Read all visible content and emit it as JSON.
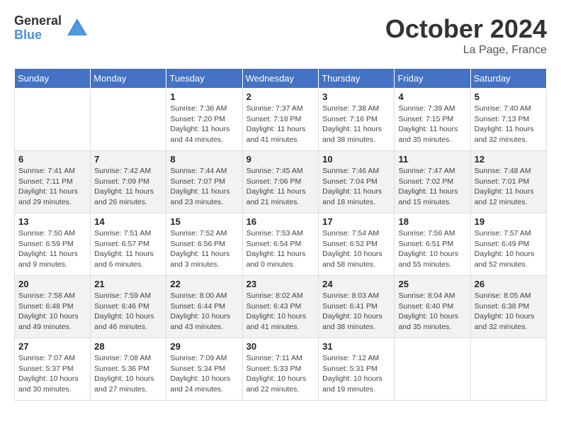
{
  "logo": {
    "general": "General",
    "blue": "Blue"
  },
  "title": "October 2024",
  "location": "La Page, France",
  "days_header": [
    "Sunday",
    "Monday",
    "Tuesday",
    "Wednesday",
    "Thursday",
    "Friday",
    "Saturday"
  ],
  "weeks": [
    [
      {
        "day": "",
        "info": ""
      },
      {
        "day": "",
        "info": ""
      },
      {
        "day": "1",
        "info": "Sunrise: 7:36 AM\nSunset: 7:20 PM\nDaylight: 11 hours and 44 minutes."
      },
      {
        "day": "2",
        "info": "Sunrise: 7:37 AM\nSunset: 7:18 PM\nDaylight: 11 hours and 41 minutes."
      },
      {
        "day": "3",
        "info": "Sunrise: 7:38 AM\nSunset: 7:16 PM\nDaylight: 11 hours and 38 minutes."
      },
      {
        "day": "4",
        "info": "Sunrise: 7:39 AM\nSunset: 7:15 PM\nDaylight: 11 hours and 35 minutes."
      },
      {
        "day": "5",
        "info": "Sunrise: 7:40 AM\nSunset: 7:13 PM\nDaylight: 11 hours and 32 minutes."
      }
    ],
    [
      {
        "day": "6",
        "info": "Sunrise: 7:41 AM\nSunset: 7:11 PM\nDaylight: 11 hours and 29 minutes."
      },
      {
        "day": "7",
        "info": "Sunrise: 7:42 AM\nSunset: 7:09 PM\nDaylight: 11 hours and 26 minutes."
      },
      {
        "day": "8",
        "info": "Sunrise: 7:44 AM\nSunset: 7:07 PM\nDaylight: 11 hours and 23 minutes."
      },
      {
        "day": "9",
        "info": "Sunrise: 7:45 AM\nSunset: 7:06 PM\nDaylight: 11 hours and 21 minutes."
      },
      {
        "day": "10",
        "info": "Sunrise: 7:46 AM\nSunset: 7:04 PM\nDaylight: 11 hours and 18 minutes."
      },
      {
        "day": "11",
        "info": "Sunrise: 7:47 AM\nSunset: 7:02 PM\nDaylight: 11 hours and 15 minutes."
      },
      {
        "day": "12",
        "info": "Sunrise: 7:48 AM\nSunset: 7:01 PM\nDaylight: 11 hours and 12 minutes."
      }
    ],
    [
      {
        "day": "13",
        "info": "Sunrise: 7:50 AM\nSunset: 6:59 PM\nDaylight: 11 hours and 9 minutes."
      },
      {
        "day": "14",
        "info": "Sunrise: 7:51 AM\nSunset: 6:57 PM\nDaylight: 11 hours and 6 minutes."
      },
      {
        "day": "15",
        "info": "Sunrise: 7:52 AM\nSunset: 6:56 PM\nDaylight: 11 hours and 3 minutes."
      },
      {
        "day": "16",
        "info": "Sunrise: 7:53 AM\nSunset: 6:54 PM\nDaylight: 11 hours and 0 minutes."
      },
      {
        "day": "17",
        "info": "Sunrise: 7:54 AM\nSunset: 6:52 PM\nDaylight: 10 hours and 58 minutes."
      },
      {
        "day": "18",
        "info": "Sunrise: 7:56 AM\nSunset: 6:51 PM\nDaylight: 10 hours and 55 minutes."
      },
      {
        "day": "19",
        "info": "Sunrise: 7:57 AM\nSunset: 6:49 PM\nDaylight: 10 hours and 52 minutes."
      }
    ],
    [
      {
        "day": "20",
        "info": "Sunrise: 7:58 AM\nSunset: 6:48 PM\nDaylight: 10 hours and 49 minutes."
      },
      {
        "day": "21",
        "info": "Sunrise: 7:59 AM\nSunset: 6:46 PM\nDaylight: 10 hours and 46 minutes."
      },
      {
        "day": "22",
        "info": "Sunrise: 8:00 AM\nSunset: 6:44 PM\nDaylight: 10 hours and 43 minutes."
      },
      {
        "day": "23",
        "info": "Sunrise: 8:02 AM\nSunset: 6:43 PM\nDaylight: 10 hours and 41 minutes."
      },
      {
        "day": "24",
        "info": "Sunrise: 8:03 AM\nSunset: 6:41 PM\nDaylight: 10 hours and 38 minutes."
      },
      {
        "day": "25",
        "info": "Sunrise: 8:04 AM\nSunset: 6:40 PM\nDaylight: 10 hours and 35 minutes."
      },
      {
        "day": "26",
        "info": "Sunrise: 8:05 AM\nSunset: 6:38 PM\nDaylight: 10 hours and 32 minutes."
      }
    ],
    [
      {
        "day": "27",
        "info": "Sunrise: 7:07 AM\nSunset: 5:37 PM\nDaylight: 10 hours and 30 minutes."
      },
      {
        "day": "28",
        "info": "Sunrise: 7:08 AM\nSunset: 5:36 PM\nDaylight: 10 hours and 27 minutes."
      },
      {
        "day": "29",
        "info": "Sunrise: 7:09 AM\nSunset: 5:34 PM\nDaylight: 10 hours and 24 minutes."
      },
      {
        "day": "30",
        "info": "Sunrise: 7:11 AM\nSunset: 5:33 PM\nDaylight: 10 hours and 22 minutes."
      },
      {
        "day": "31",
        "info": "Sunrise: 7:12 AM\nSunset: 5:31 PM\nDaylight: 10 hours and 19 minutes."
      },
      {
        "day": "",
        "info": ""
      },
      {
        "day": "",
        "info": ""
      }
    ]
  ]
}
